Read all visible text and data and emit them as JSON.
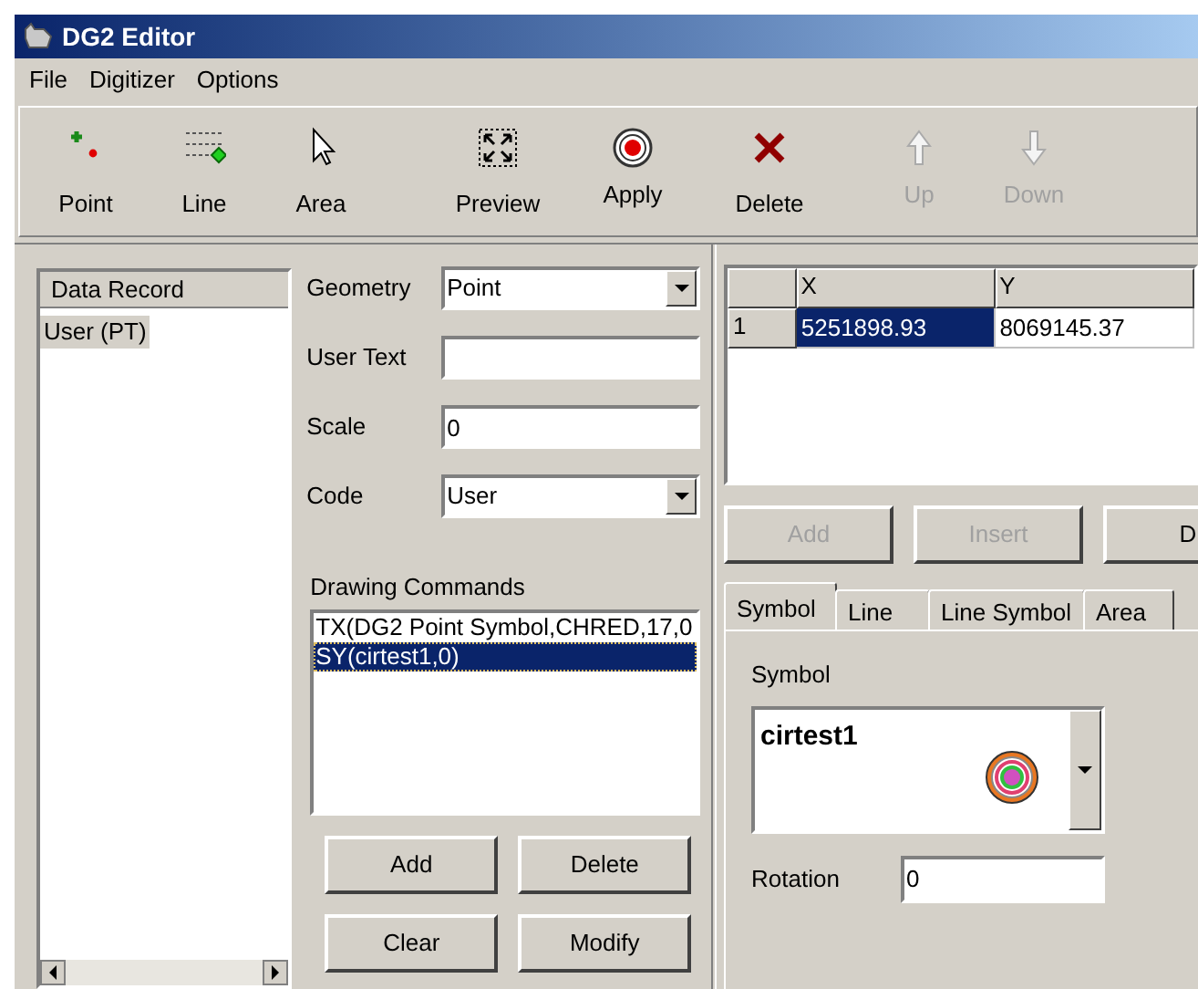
{
  "window": {
    "title": "DG2 Editor"
  },
  "menu": [
    "File",
    "Digitizer",
    "Options"
  ],
  "toolbar": [
    {
      "label": "Point",
      "kind": "point",
      "disabled": false
    },
    {
      "label": "Line",
      "kind": "line",
      "disabled": false
    },
    {
      "label": "Area",
      "kind": "area",
      "disabled": false
    },
    {
      "label": "Preview",
      "kind": "preview",
      "disabled": false
    },
    {
      "label": "Apply",
      "kind": "apply",
      "disabled": false
    },
    {
      "label": "Delete",
      "kind": "delete",
      "disabled": false
    },
    {
      "label": "Up",
      "kind": "up",
      "disabled": true
    },
    {
      "label": "Down",
      "kind": "down",
      "disabled": true
    }
  ],
  "data_record": {
    "header": "Data Record",
    "items": [
      {
        "label": "User (PT)",
        "selected": true
      }
    ]
  },
  "form": [
    {
      "kind": "select",
      "label": "Geometry",
      "value": "Point"
    },
    {
      "kind": "text",
      "label": "User Text"
    },
    {
      "kind": "text",
      "label": "Scale",
      "value": "0"
    },
    {
      "kind": "select",
      "label": "Code",
      "value": "User"
    }
  ],
  "drawing_commands": {
    "label": "Drawing Commands",
    "items": [
      {
        "text": "TX(DG2 Point Symbol,CHRED,17,0",
        "selected": false
      },
      {
        "text": "SY(cirtest1,0)",
        "selected": true
      }
    ],
    "buttons": [
      "Add",
      "Delete",
      "Clear",
      "Modify"
    ]
  },
  "coordinates": {
    "columns": [
      "X",
      "Y"
    ],
    "rows": [
      {
        "number": "1",
        "cells": [
          {
            "text": "5251898.93",
            "selected": true
          },
          {
            "text": "8069145.37",
            "selected": false
          }
        ]
      }
    ],
    "buttons": [
      {
        "label": "Add",
        "disabled": true
      },
      {
        "label": "Insert",
        "disabled": true
      },
      {
        "label": "D",
        "disabled": false
      }
    ]
  },
  "tabs": [
    {
      "label": "Symbol",
      "selected": true
    },
    {
      "label": "Line",
      "selected": false
    },
    {
      "label": "Line Symbol",
      "selected": false
    },
    {
      "label": "Area",
      "selected": false
    }
  ],
  "symbol_panel": {
    "label": "Symbol",
    "value": "cirtest1",
    "rotation_label": "Rotation",
    "rotation": "0"
  }
}
